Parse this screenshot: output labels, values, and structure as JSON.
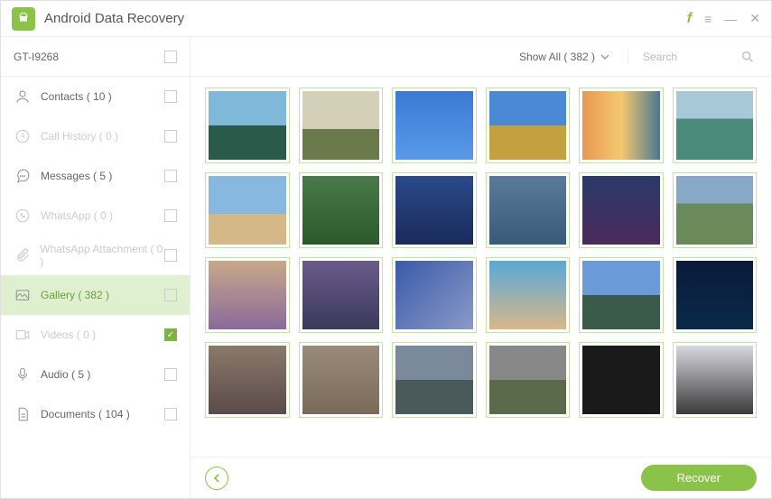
{
  "app": {
    "title": "Android Data Recovery"
  },
  "device": {
    "name": "GT-I9268"
  },
  "categories": [
    {
      "id": "contacts",
      "label": "Contacts ( 10 )",
      "disabled": false,
      "active": false,
      "checked": false,
      "icon": "user"
    },
    {
      "id": "callhistory",
      "label": "Call History ( 0 )",
      "disabled": true,
      "active": false,
      "checked": false,
      "icon": "clock"
    },
    {
      "id": "messages",
      "label": "Messages ( 5 )",
      "disabled": false,
      "active": false,
      "checked": false,
      "icon": "chat"
    },
    {
      "id": "whatsapp",
      "label": "WhatsApp ( 0 )",
      "disabled": true,
      "active": false,
      "checked": false,
      "icon": "whatsapp"
    },
    {
      "id": "whatsappatt",
      "label": "WhatsApp Attachment ( 0 )",
      "disabled": true,
      "active": false,
      "checked": false,
      "icon": "attach"
    },
    {
      "id": "gallery",
      "label": "Gallery ( 382 )",
      "disabled": false,
      "active": true,
      "checked": false,
      "icon": "image"
    },
    {
      "id": "videos",
      "label": "Videos ( 0 )",
      "disabled": true,
      "active": false,
      "checked": true,
      "icon": "video"
    },
    {
      "id": "audio",
      "label": "Audio ( 5 )",
      "disabled": false,
      "active": false,
      "checked": false,
      "icon": "mic"
    },
    {
      "id": "documents",
      "label": "Documents ( 104 )",
      "disabled": false,
      "active": false,
      "checked": false,
      "icon": "doc"
    }
  ],
  "filter": {
    "label": "Show All ( 382 )"
  },
  "search": {
    "placeholder": "Search"
  },
  "footer": {
    "recover": "Recover"
  },
  "thumbs": 24
}
